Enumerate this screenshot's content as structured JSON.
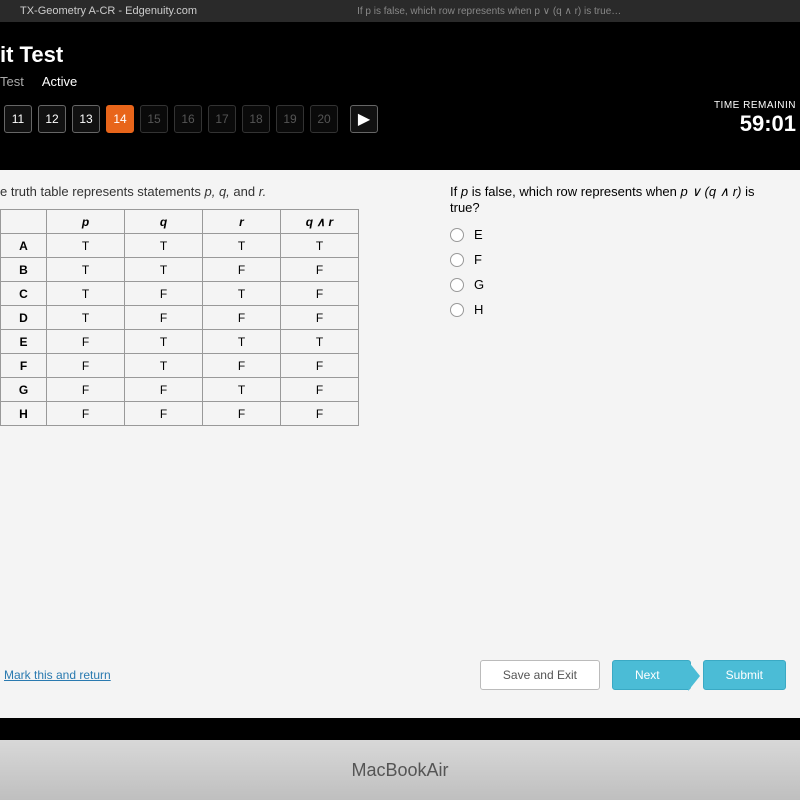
{
  "browser": {
    "tab1": "TX-Geometry A-CR - Edgenuity.com",
    "tab2": "If p is false, which row represents when p ∨ (q ∧ r) is true…"
  },
  "header": {
    "title_suffix": "it Test",
    "tabs": {
      "test": "Test",
      "active": "Active"
    },
    "questions": {
      "done": [
        "11",
        "12",
        "13"
      ],
      "current": "14",
      "upcoming": [
        "15",
        "16",
        "17",
        "18",
        "19",
        "20"
      ]
    },
    "play_icon": "▶",
    "timer": {
      "label": "TIME REMAININ",
      "value": "59:01"
    },
    "cursor_icon": "↖"
  },
  "content": {
    "left_stmt_prefix": "e truth table represents statements ",
    "left_stmt_vars": "p, q, ",
    "left_stmt_and": "and ",
    "left_stmt_r": "r.",
    "table": {
      "headers": [
        "",
        "p",
        "q",
        "r",
        "q ∧ r"
      ],
      "rows": [
        {
          "label": "A",
          "cells": [
            "T",
            "T",
            "T",
            "T"
          ]
        },
        {
          "label": "B",
          "cells": [
            "T",
            "T",
            "F",
            "F"
          ]
        },
        {
          "label": "C",
          "cells": [
            "T",
            "F",
            "T",
            "F"
          ]
        },
        {
          "label": "D",
          "cells": [
            "T",
            "F",
            "F",
            "F"
          ]
        },
        {
          "label": "E",
          "cells": [
            "F",
            "T",
            "T",
            "T"
          ]
        },
        {
          "label": "F",
          "cells": [
            "F",
            "T",
            "F",
            "F"
          ]
        },
        {
          "label": "G",
          "cells": [
            "F",
            "F",
            "T",
            "F"
          ]
        },
        {
          "label": "H",
          "cells": [
            "F",
            "F",
            "F",
            "F"
          ]
        }
      ]
    },
    "question_prefix": "If ",
    "question_p": "p",
    "question_mid": " is false, which row represents when ",
    "question_expr": "p ∨ (q ∧ r)",
    "question_suffix": " is true?",
    "options": [
      "E",
      "F",
      "G",
      "H"
    ]
  },
  "footer": {
    "mark": "Mark this and return",
    "save": "Save and Exit",
    "next": "Next",
    "submit": "Submit"
  },
  "bezel": {
    "brand": "MacBook ",
    "model": "Air"
  }
}
